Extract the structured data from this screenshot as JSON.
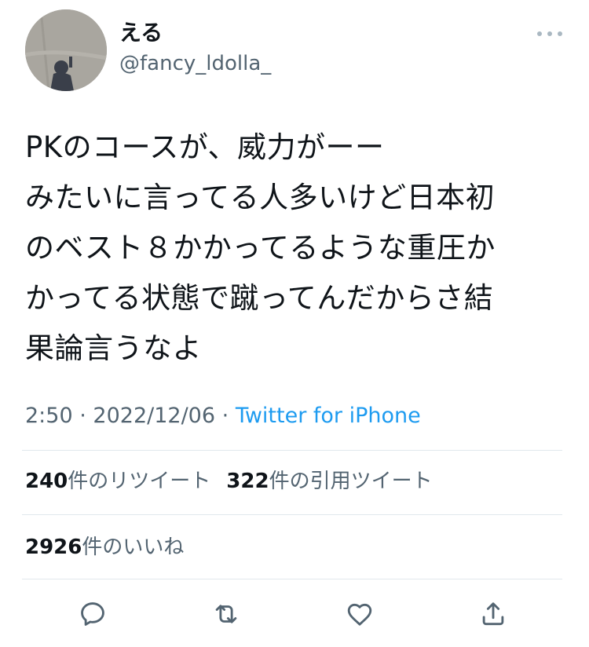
{
  "tweet": {
    "display_name": "える",
    "handle": "@fancy_ldolla_",
    "text": "PKのコースが、威力がーー\nみたいに言ってる人多いけど日本初\nのベスト８かかってるような重圧か\nかってる状態で蹴ってんだからさ結\n果論言うなよ",
    "time": "2:50",
    "separator": "·",
    "date": "2022/12/06",
    "source": "Twitter for iPhone"
  },
  "stats": {
    "retweets_count": "240",
    "retweets_label": "件のリツイート",
    "quotes_count": "322",
    "quotes_label": "件の引用ツイート",
    "likes_count": "2926",
    "likes_label": "件のいいね"
  },
  "icons": {
    "more": "more-horizontal-icon",
    "reply": "reply-icon",
    "retweet": "retweet-icon",
    "like": "heart-icon",
    "share": "share-icon"
  },
  "colors": {
    "accent": "#1d9bf0",
    "secondary_text": "#536471",
    "divider": "#e1e8ed"
  }
}
